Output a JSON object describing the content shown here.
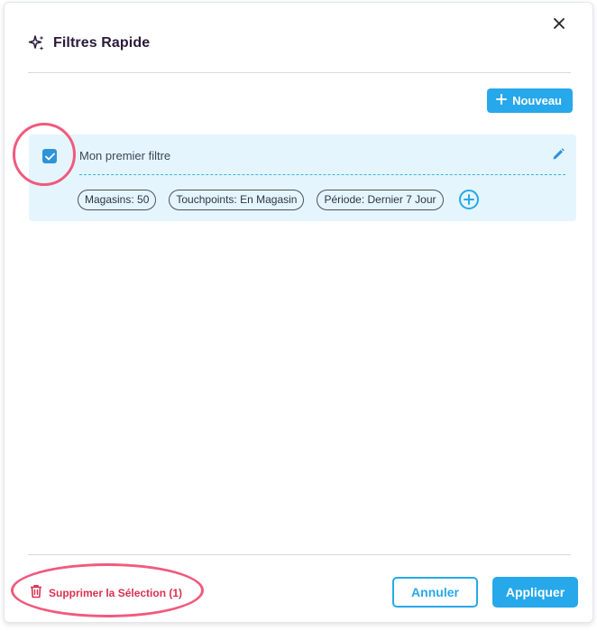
{
  "dialog": {
    "title": "Filtres Rapide",
    "title_icon": "sparkle-icon",
    "close_icon": "close-icon"
  },
  "toolbar": {
    "new_label": "Nouveau",
    "new_icon": "plus-icon"
  },
  "filters": [
    {
      "name": "Mon premier filtre",
      "checked": true,
      "edit_icon": "pencil-icon",
      "chips": [
        "Magasins: 50",
        "Touchpoints: En Magasin",
        "Période: Dernier 7 Jour"
      ],
      "add_icon": "plus-circle-icon"
    }
  ],
  "footer": {
    "delete_label": "Supprimer la Sélection (1)",
    "delete_icon": "trash-icon",
    "cancel_label": "Annuler",
    "apply_label": "Appliquer"
  },
  "colors": {
    "accent": "#27a8ea",
    "checkbox": "#2e93d9",
    "card_bg": "#e5f5fd",
    "danger": "#d9314f",
    "highlight": "#f05a7d"
  }
}
